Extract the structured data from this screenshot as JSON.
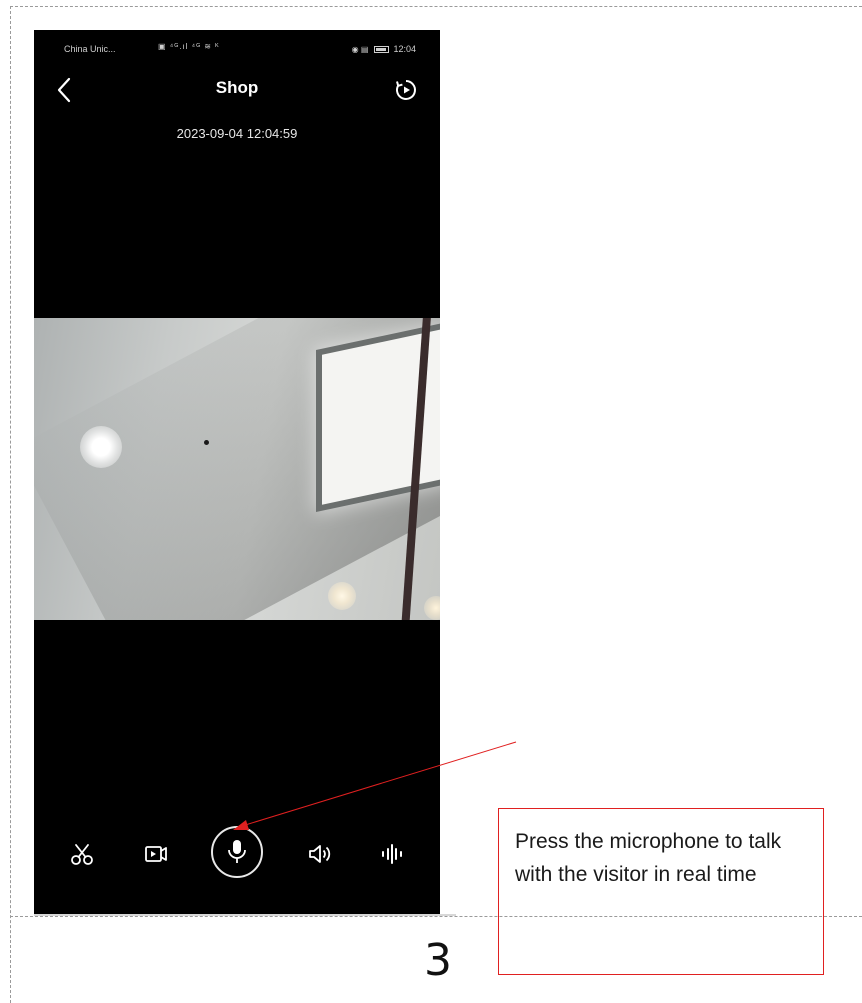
{
  "statusbar": {
    "carrier": "China Unic...",
    "signal_text": "▣ ⁴ᴳ.ıl ⁴ᴳ ≋ ᴷ",
    "right_icons": "◉ ▤",
    "time": "12:04"
  },
  "navbar": {
    "title": "Shop",
    "back_icon": "chevron-left-icon",
    "playback_icon": "playback-icon"
  },
  "video": {
    "timestamp": "2023-09-04 12:04:59"
  },
  "controls": [
    {
      "name": "scissors-icon",
      "label": ""
    },
    {
      "name": "record-icon",
      "label": ""
    },
    {
      "name": "microphone-icon",
      "label": ""
    },
    {
      "name": "speaker-icon",
      "label": ""
    },
    {
      "name": "waveform-icon",
      "label": ""
    }
  ],
  "annotation": {
    "text": "Press the microphone to talk with the visitor in real time",
    "color": "#e02020"
  },
  "page": {
    "number": "3"
  }
}
